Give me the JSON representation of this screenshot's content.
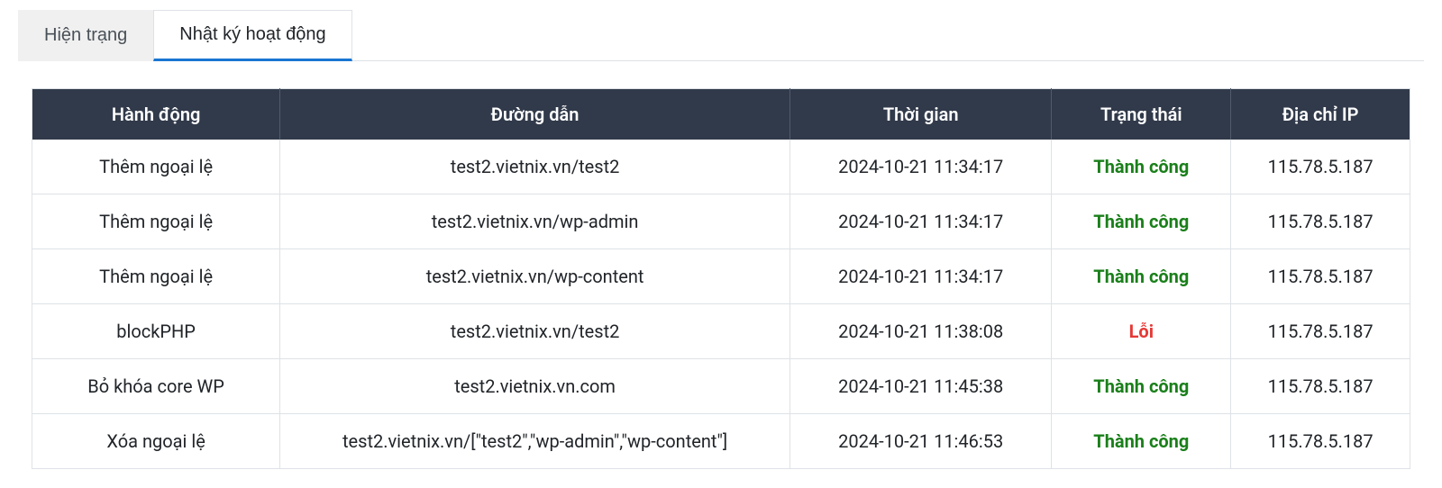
{
  "tabs": {
    "status": "Hiện trạng",
    "activity_log": "Nhật ký hoạt động"
  },
  "table": {
    "headers": {
      "action": "Hành động",
      "path": "Đường dẫn",
      "time": "Thời gian",
      "status": "Trạng thái",
      "ip": "Địa chỉ IP"
    },
    "rows": [
      {
        "action": "Thêm ngoại lệ",
        "path": "test2.vietnix.vn/test2",
        "time": "2024-10-21 11:34:17",
        "status": "Thành công",
        "status_type": "success",
        "ip": "115.78.5.187"
      },
      {
        "action": "Thêm ngoại lệ",
        "path": "test2.vietnix.vn/wp-admin",
        "time": "2024-10-21 11:34:17",
        "status": "Thành công",
        "status_type": "success",
        "ip": "115.78.5.187"
      },
      {
        "action": "Thêm ngoại lệ",
        "path": "test2.vietnix.vn/wp-content",
        "time": "2024-10-21 11:34:17",
        "status": "Thành công",
        "status_type": "success",
        "ip": "115.78.5.187"
      },
      {
        "action": "blockPHP",
        "path": "test2.vietnix.vn/test2",
        "time": "2024-10-21 11:38:08",
        "status": "Lỗi",
        "status_type": "error",
        "ip": "115.78.5.187"
      },
      {
        "action": "Bỏ khóa core WP",
        "path": "test2.vietnix.vn.com",
        "time": "2024-10-21 11:45:38",
        "status": "Thành công",
        "status_type": "success",
        "ip": "115.78.5.187"
      },
      {
        "action": "Xóa ngoại lệ",
        "path": "test2.vietnix.vn/[\"test2\",\"wp-admin\",\"wp-content\"]",
        "time": "2024-10-21 11:46:53",
        "status": "Thành công",
        "status_type": "success",
        "ip": "115.78.5.187"
      }
    ]
  }
}
